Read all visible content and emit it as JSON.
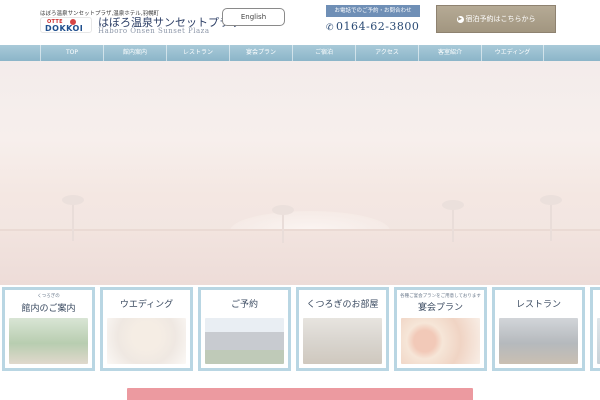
{
  "header": {
    "tagline": "はぼろ温泉サンセットプラザ,温泉ホテル,羽幌町",
    "logo": {
      "top": "OTTE",
      "main": "DOKKOI"
    },
    "brand_name": "はぼろ温泉サンセットプラザ",
    "brand_roman": "Haboro Onsen Sunset Plaza",
    "language_button": "English",
    "contact_label": "お電話でのご予約・お問合わせ",
    "phone": "0164-62-3800",
    "reserve_button": "宿泊予約はこちらから"
  },
  "nav": {
    "items": [
      "TOP",
      "館内案内",
      "レストラン",
      "宴会プラン",
      "ご宿泊",
      "アクセス",
      "客室紹介",
      "ウエディング"
    ]
  },
  "banners": [
    {
      "small": "くつろぎの",
      "title": "館内のご案内"
    },
    {
      "small": "",
      "title": "ウエディング"
    },
    {
      "small": "",
      "title": "ご予約"
    },
    {
      "small": "",
      "title": "くつろぎのお部屋"
    },
    {
      "small": "各種ご宴会プランをご用意しております",
      "title": "宴会プラン"
    },
    {
      "small": "",
      "title": "レストラン"
    }
  ],
  "colors": {
    "nav": "#8bb5c9",
    "banner_border": "#b9d6e3",
    "reserve": "#a29680",
    "contact_label": "#6f8fb6",
    "bottom_bar": "#ec9aa0"
  }
}
